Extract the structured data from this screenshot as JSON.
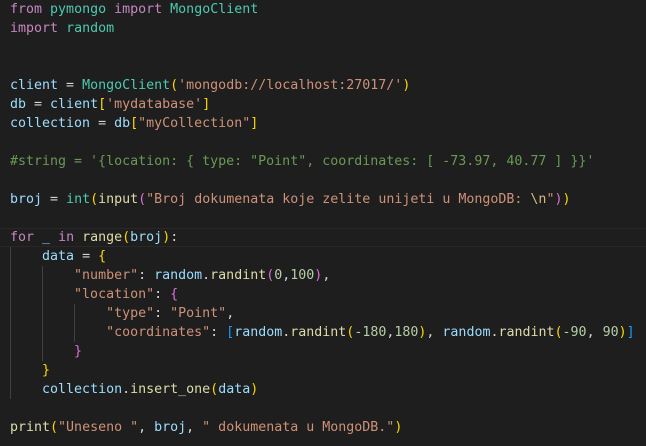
{
  "editor": {
    "theme_colors": {
      "background": "#1e1e1e",
      "keyword": "#c586c0",
      "function": "#dcdcaa",
      "class": "#4ec9b0",
      "variable": "#9cdcfe",
      "string": "#ce9178",
      "number": "#b5cea8",
      "comment": "#6a9955"
    },
    "lines": [
      [
        {
          "t": "kw",
          "v": "from"
        },
        {
          "t": "op",
          "v": " "
        },
        {
          "t": "mod",
          "v": "pymongo"
        },
        {
          "t": "op",
          "v": " "
        },
        {
          "t": "kw",
          "v": "import"
        },
        {
          "t": "op",
          "v": " "
        },
        {
          "t": "cls",
          "v": "MongoClient"
        }
      ],
      [
        {
          "t": "kw",
          "v": "import"
        },
        {
          "t": "op",
          "v": " "
        },
        {
          "t": "mod",
          "v": "random"
        }
      ],
      [],
      [],
      [
        {
          "t": "var",
          "v": "client"
        },
        {
          "t": "op",
          "v": " = "
        },
        {
          "t": "cls",
          "v": "MongoClient"
        },
        {
          "t": "br1",
          "v": "("
        },
        {
          "t": "str",
          "v": "'mongodb://localhost:27017/'"
        },
        {
          "t": "br1",
          "v": ")"
        }
      ],
      [
        {
          "t": "var",
          "v": "db"
        },
        {
          "t": "op",
          "v": " = "
        },
        {
          "t": "var",
          "v": "client"
        },
        {
          "t": "br1",
          "v": "["
        },
        {
          "t": "str",
          "v": "'mydatabase'"
        },
        {
          "t": "br1",
          "v": "]"
        }
      ],
      [
        {
          "t": "var",
          "v": "collection"
        },
        {
          "t": "op",
          "v": " = "
        },
        {
          "t": "var",
          "v": "db"
        },
        {
          "t": "br1",
          "v": "["
        },
        {
          "t": "str",
          "v": "\"myCollection\""
        },
        {
          "t": "br1",
          "v": "]"
        }
      ],
      [],
      [
        {
          "t": "com",
          "v": "#string = '{location: { type: \"Point\", coordinates: [ -73.97, 40.77 ] }}'"
        }
      ],
      [],
      [
        {
          "t": "var",
          "v": "broj"
        },
        {
          "t": "op",
          "v": " = "
        },
        {
          "t": "cls",
          "v": "int"
        },
        {
          "t": "br1",
          "v": "("
        },
        {
          "t": "fn",
          "v": "input"
        },
        {
          "t": "br2",
          "v": "("
        },
        {
          "t": "str",
          "v": "\"Broj dokumenata koje zelite unijeti u MongoDB: "
        },
        {
          "t": "esc",
          "v": "\\n"
        },
        {
          "t": "str",
          "v": "\""
        },
        {
          "t": "br2",
          "v": ")"
        },
        {
          "t": "br1",
          "v": ")"
        }
      ],
      [],
      [
        {
          "t": "kw",
          "v": "for"
        },
        {
          "t": "op",
          "v": " "
        },
        {
          "t": "var",
          "v": "_"
        },
        {
          "t": "op",
          "v": " "
        },
        {
          "t": "kw",
          "v": "in"
        },
        {
          "t": "op",
          "v": " "
        },
        {
          "t": "fn",
          "v": "range"
        },
        {
          "t": "br1",
          "v": "("
        },
        {
          "t": "var",
          "v": "broj"
        },
        {
          "t": "br1",
          "v": ")"
        },
        {
          "t": "op",
          "v": ":"
        }
      ],
      [
        {
          "t": "op",
          "v": "    "
        },
        {
          "t": "var",
          "v": "data"
        },
        {
          "t": "op",
          "v": " = "
        },
        {
          "t": "br1",
          "v": "{"
        }
      ],
      [
        {
          "t": "op",
          "v": "        "
        },
        {
          "t": "str",
          "v": "\"number\""
        },
        {
          "t": "op",
          "v": ": "
        },
        {
          "t": "var",
          "v": "random"
        },
        {
          "t": "op",
          "v": "."
        },
        {
          "t": "fn",
          "v": "randint"
        },
        {
          "t": "br2",
          "v": "("
        },
        {
          "t": "num",
          "v": "0"
        },
        {
          "t": "op",
          "v": ","
        },
        {
          "t": "num",
          "v": "100"
        },
        {
          "t": "br2",
          "v": ")"
        },
        {
          "t": "op",
          "v": ","
        }
      ],
      [
        {
          "t": "op",
          "v": "        "
        },
        {
          "t": "str",
          "v": "\"location\""
        },
        {
          "t": "op",
          "v": ": "
        },
        {
          "t": "br2",
          "v": "{"
        }
      ],
      [
        {
          "t": "op",
          "v": "            "
        },
        {
          "t": "str",
          "v": "\"type\""
        },
        {
          "t": "op",
          "v": ": "
        },
        {
          "t": "str",
          "v": "\"Point\""
        },
        {
          "t": "op",
          "v": ","
        }
      ],
      [
        {
          "t": "op",
          "v": "            "
        },
        {
          "t": "str",
          "v": "\"coordinates\""
        },
        {
          "t": "op",
          "v": ": "
        },
        {
          "t": "br3",
          "v": "["
        },
        {
          "t": "var",
          "v": "random"
        },
        {
          "t": "op",
          "v": "."
        },
        {
          "t": "fn",
          "v": "randint"
        },
        {
          "t": "br1",
          "v": "("
        },
        {
          "t": "num",
          "v": "-180"
        },
        {
          "t": "op",
          "v": ","
        },
        {
          "t": "num",
          "v": "180"
        },
        {
          "t": "br1",
          "v": ")"
        },
        {
          "t": "op",
          "v": ", "
        },
        {
          "t": "var",
          "v": "random"
        },
        {
          "t": "op",
          "v": "."
        },
        {
          "t": "fn",
          "v": "randint"
        },
        {
          "t": "br1",
          "v": "("
        },
        {
          "t": "num",
          "v": "-90"
        },
        {
          "t": "op",
          "v": ", "
        },
        {
          "t": "num",
          "v": "90"
        },
        {
          "t": "br1",
          "v": ")"
        },
        {
          "t": "br3",
          "v": "]"
        }
      ],
      [
        {
          "t": "op",
          "v": "        "
        },
        {
          "t": "br2",
          "v": "}"
        }
      ],
      [
        {
          "t": "op",
          "v": "    "
        },
        {
          "t": "br1",
          "v": "}"
        }
      ],
      [
        {
          "t": "op",
          "v": "    "
        },
        {
          "t": "var",
          "v": "collection"
        },
        {
          "t": "op",
          "v": "."
        },
        {
          "t": "fn",
          "v": "insert_one"
        },
        {
          "t": "br1",
          "v": "("
        },
        {
          "t": "var",
          "v": "data"
        },
        {
          "t": "br1",
          "v": ")"
        }
      ],
      [],
      [
        {
          "t": "fn",
          "v": "print"
        },
        {
          "t": "br1",
          "v": "("
        },
        {
          "t": "str",
          "v": "\"Uneseno \""
        },
        {
          "t": "op",
          "v": ", "
        },
        {
          "t": "var",
          "v": "broj"
        },
        {
          "t": "op",
          "v": ", "
        },
        {
          "t": "str",
          "v": "\" dokumenata u MongoDB.\""
        },
        {
          "t": "br1",
          "v": ")"
        }
      ]
    ]
  }
}
